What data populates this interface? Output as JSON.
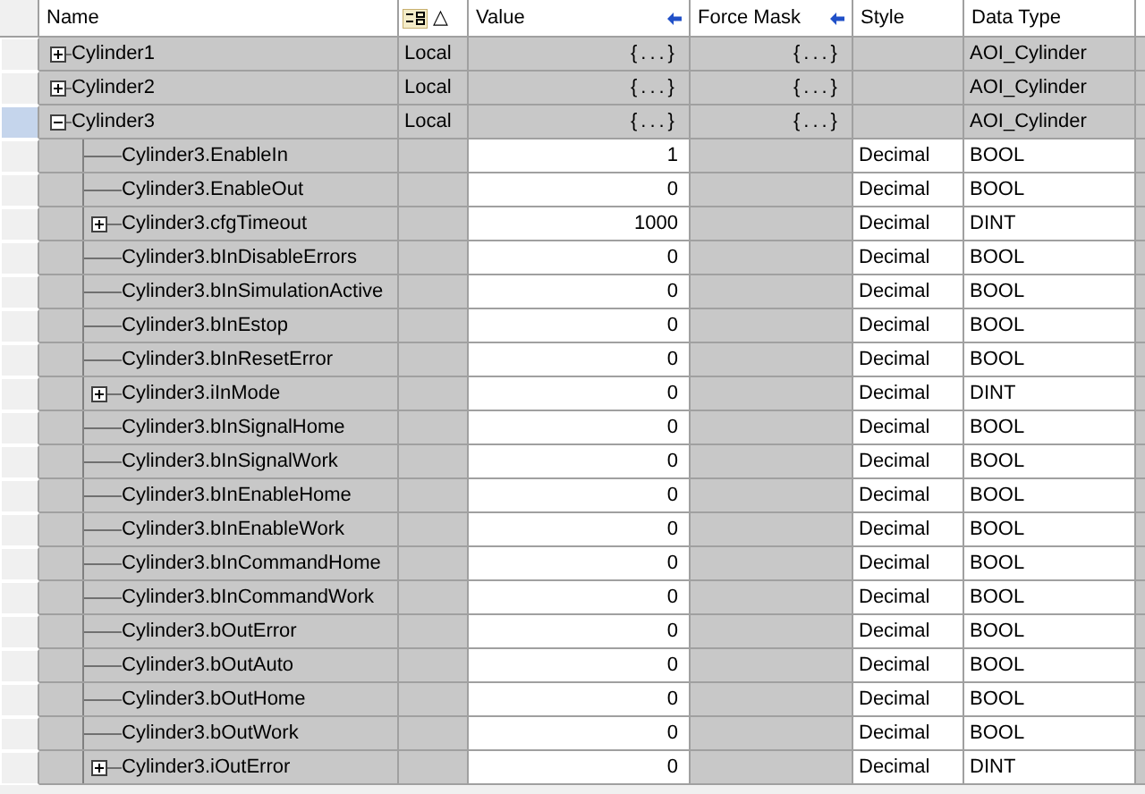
{
  "columns": {
    "name": "Name",
    "scope_sort": "△",
    "value": "Value",
    "force_mask": "Force Mask",
    "style": "Style",
    "data_type": "Data Type"
  },
  "tags": [
    {
      "name": "Cylinder1",
      "scope": "Local",
      "value": "{...}",
      "force_mask": "{...}",
      "data_type": "AOI_Cylinder",
      "expanded": false,
      "selected": false
    },
    {
      "name": "Cylinder2",
      "scope": "Local",
      "value": "{...}",
      "force_mask": "{...}",
      "data_type": "AOI_Cylinder",
      "expanded": false,
      "selected": false
    },
    {
      "name": "Cylinder3",
      "scope": "Local",
      "value": "{...}",
      "force_mask": "{...}",
      "data_type": "AOI_Cylinder",
      "expanded": true,
      "selected": true,
      "children": [
        {
          "name": "Cylinder3.EnableIn",
          "value": "1",
          "style": "Decimal",
          "data_type": "BOOL",
          "expandable": false,
          "selected": false
        },
        {
          "name": "Cylinder3.EnableOut",
          "value": "0",
          "style": "Decimal",
          "data_type": "BOOL",
          "expandable": false,
          "selected": false
        },
        {
          "name": "Cylinder3.cfgTimeout",
          "value": "1000",
          "style": "Decimal",
          "data_type": "DINT",
          "expandable": true,
          "selected": false
        },
        {
          "name": "Cylinder3.bInDisableErrors",
          "value": "0",
          "style": "Decimal",
          "data_type": "BOOL",
          "expandable": false,
          "selected": false
        },
        {
          "name": "Cylinder3.bInSimulationActive",
          "value": "0",
          "style": "Decimal",
          "data_type": "BOOL",
          "expandable": false,
          "selected": false
        },
        {
          "name": "Cylinder3.bInEstop",
          "value": "0",
          "style": "Decimal",
          "data_type": "BOOL",
          "expandable": false,
          "selected": false
        },
        {
          "name": "Cylinder3.bInResetError",
          "value": "0",
          "style": "Decimal",
          "data_type": "BOOL",
          "expandable": false,
          "selected": false
        },
        {
          "name": "Cylinder3.iInMode",
          "value": "0",
          "style": "Decimal",
          "data_type": "DINT",
          "expandable": true,
          "selected": false
        },
        {
          "name": "Cylinder3.bInSignalHome",
          "value": "0",
          "style": "Decimal",
          "data_type": "BOOL",
          "expandable": false,
          "selected": false
        },
        {
          "name": "Cylinder3.bInSignalWork",
          "value": "0",
          "style": "Decimal",
          "data_type": "BOOL",
          "expandable": false,
          "selected": false
        },
        {
          "name": "Cylinder3.bInEnableHome",
          "value": "0",
          "style": "Decimal",
          "data_type": "BOOL",
          "expandable": false,
          "selected": false
        },
        {
          "name": "Cylinder3.bInEnableWork",
          "value": "0",
          "style": "Decimal",
          "data_type": "BOOL",
          "expandable": false,
          "selected": false
        },
        {
          "name": "Cylinder3.bInCommandHome",
          "value": "0",
          "style": "Decimal",
          "data_type": "BOOL",
          "expandable": false,
          "selected": false
        },
        {
          "name": "Cylinder3.bInCommandWork",
          "value": "0",
          "style": "Decimal",
          "data_type": "BOOL",
          "expandable": false,
          "selected": false
        },
        {
          "name": "Cylinder3.bOutError",
          "value": "0",
          "style": "Decimal",
          "data_type": "BOOL",
          "expandable": false,
          "selected": false
        },
        {
          "name": "Cylinder3.bOutAuto",
          "value": "0",
          "style": "Decimal",
          "data_type": "BOOL",
          "expandable": false,
          "selected": false
        },
        {
          "name": "Cylinder3.bOutHome",
          "value": "0",
          "style": "Decimal",
          "data_type": "BOOL",
          "expandable": false,
          "selected": false
        },
        {
          "name": "Cylinder3.bOutWork",
          "value": "0",
          "style": "Decimal",
          "data_type": "BOOL",
          "expandable": false,
          "selected": false
        },
        {
          "name": "Cylinder3.iOutError",
          "value": "0",
          "style": "Decimal",
          "data_type": "DINT",
          "expandable": true,
          "selected": false
        }
      ]
    }
  ]
}
